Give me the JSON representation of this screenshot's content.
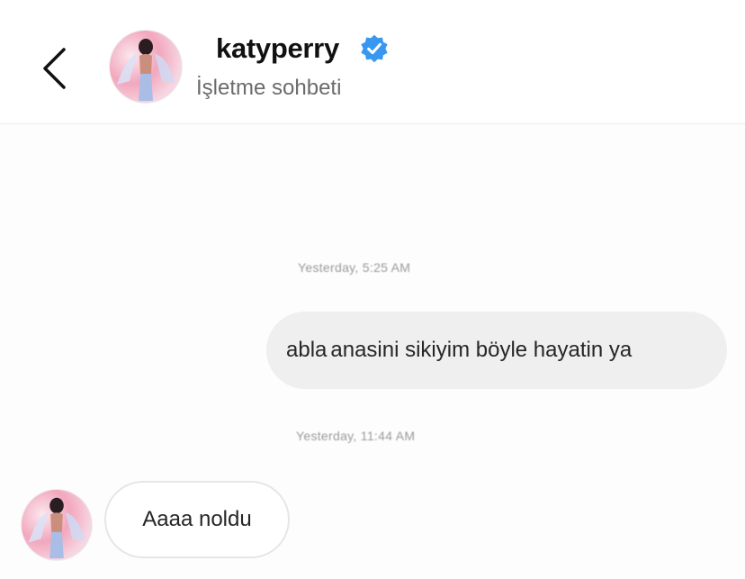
{
  "header": {
    "username": "katyperry",
    "subtitle": "İşletme sohbeti",
    "verified": true,
    "back_icon": "chevron-left-icon",
    "verified_icon": "verified-badge-icon",
    "verified_color": "#3897f0"
  },
  "messages": [
    {
      "type": "timestamp",
      "text": "Yesterday, 5:25 AM"
    },
    {
      "type": "outgoing",
      "word_prefix": "abla",
      "word_rest": "anasini sikiyim böyle hayatin ya"
    },
    {
      "type": "timestamp",
      "text": "Yesterday, 11:44 AM"
    },
    {
      "type": "incoming",
      "text": "Aaaa noldu"
    }
  ]
}
